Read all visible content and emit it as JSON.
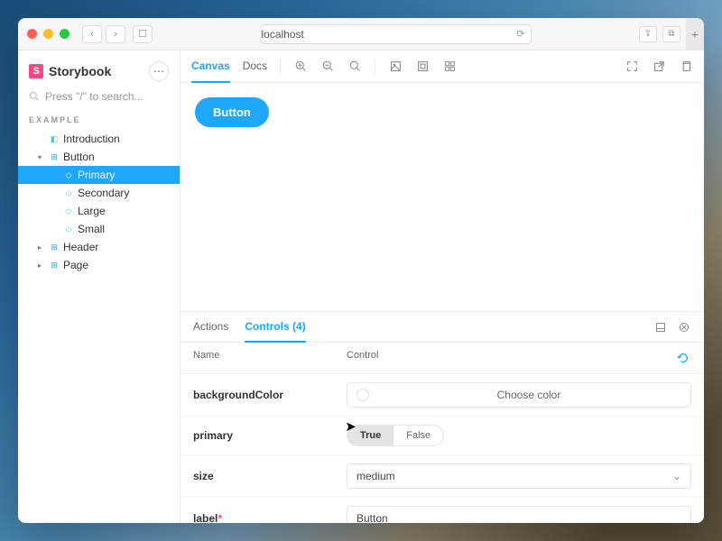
{
  "browser": {
    "address": "localhost",
    "actions": {
      "back": "‹",
      "forward": "›",
      "sidebar": "☐",
      "refresh": "⟳",
      "share": "⇪",
      "tabs": "⧉",
      "newtab": "+"
    }
  },
  "sidebar": {
    "brand": "Storybook",
    "menu_icon": "⋯",
    "search_placeholder": "Press \"/\" to search...",
    "section": "EXAMPLE",
    "tree": [
      {
        "label": "Introduction",
        "kind": "doc",
        "level": 1
      },
      {
        "label": "Button",
        "kind": "component",
        "level": 1,
        "expanded": true
      },
      {
        "label": "Primary",
        "kind": "story",
        "level": 2,
        "active": true
      },
      {
        "label": "Secondary",
        "kind": "story",
        "level": 2
      },
      {
        "label": "Large",
        "kind": "story",
        "level": 2
      },
      {
        "label": "Small",
        "kind": "story",
        "level": 2
      },
      {
        "label": "Header",
        "kind": "component",
        "level": 1,
        "expanded": false
      },
      {
        "label": "Page",
        "kind": "component",
        "level": 1,
        "expanded": false
      }
    ]
  },
  "toolbar": {
    "tabs": [
      {
        "label": "Canvas",
        "active": true
      },
      {
        "label": "Docs",
        "active": false
      }
    ],
    "icons": [
      "zoom-in",
      "zoom-out",
      "zoom-reset",
      "sep",
      "background",
      "viewport",
      "grid",
      "spacer",
      "fullscreen",
      "open-new",
      "copy-link"
    ]
  },
  "preview": {
    "button_label": "Button"
  },
  "addons": {
    "tabs": [
      {
        "label": "Actions",
        "active": false
      },
      {
        "label": "Controls (4)",
        "active": true
      }
    ],
    "head": {
      "name": "Name",
      "control": "Control"
    },
    "controls": [
      {
        "name": "backgroundColor",
        "type": "color",
        "placeholder": "Choose color"
      },
      {
        "name": "primary",
        "type": "boolean",
        "value": "True",
        "options": [
          "True",
          "False"
        ]
      },
      {
        "name": "size",
        "type": "select",
        "value": "medium"
      },
      {
        "name": "label",
        "type": "text",
        "value": "Button",
        "required": true
      }
    ]
  }
}
